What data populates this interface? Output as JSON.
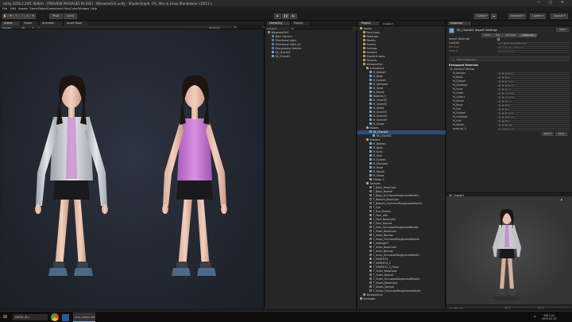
{
  "window": {
    "title": "Unity 2018.2.20f1 (64bit) - [PREVIEW PACKAGES IN USE] - WinsomeGirl.unity - ShaderGraph - PC, Mac & Linux Standalone <DX11>"
  },
  "menu": [
    "File",
    "Edit",
    "Assets",
    "GameObject",
    "Component",
    "PolyCube",
    "Window",
    "Help"
  ],
  "toolbar": {
    "pivot": "Pivot",
    "space": "Local",
    "collab": "Collab ▾",
    "account": "Account ▾",
    "layers": "Layers ▾",
    "layout": "Layout ▾"
  },
  "scene": {
    "tabs": [
      "Scene",
      "Game",
      "Animator",
      "Asset Store"
    ],
    "shading": "Shaded",
    "mode": "2D",
    "gizmos": "Gizmos ▾",
    "search": "All"
  },
  "hierarchy": {
    "tab": "Hierarchy",
    "project_tab": "Project",
    "create": "Create ▾",
    "search": "All",
    "items": [
      {
        "label": "WinsomeGirl*",
        "indent": 0,
        "icon": "scene"
      },
      {
        "label": "Main Camera",
        "indent": 1,
        "icon": "go"
      },
      {
        "label": "Directional Light",
        "indent": 1,
        "icon": "go"
      },
      {
        "label": "Directional Light (1)",
        "indent": 1,
        "icon": "go"
      },
      {
        "label": "Post-process Volume",
        "indent": 1,
        "icon": "go"
      },
      {
        "label": "SK_Chara01",
        "indent": 1,
        "icon": "prefab"
      },
      {
        "label": "SK_Chara01",
        "indent": 1,
        "icon": "prefab"
      }
    ]
  },
  "project": {
    "create": "Create ▾",
    "items": [
      {
        "label": "Assets",
        "indent": 0,
        "icon": "folder",
        "sel": false
      },
      {
        "label": "PolyCubes",
        "indent": 1,
        "icon": "folder",
        "sel": false
      },
      {
        "label": "Materials",
        "indent": 1,
        "icon": "folder",
        "sel": false
      },
      {
        "label": "Models",
        "indent": 1,
        "icon": "folder",
        "sel": false
      },
      {
        "label": "Scenes",
        "indent": 1,
        "icon": "folder",
        "sel": false
      },
      {
        "label": "Settings",
        "indent": 1,
        "icon": "folder",
        "sel": false
      },
      {
        "label": "Shaders",
        "indent": 1,
        "icon": "folder",
        "sel": false
      },
      {
        "label": "ShaderGraphs",
        "indent": 1,
        "icon": "folder",
        "sel": false
      },
      {
        "label": "Textures",
        "indent": 1,
        "icon": "folder",
        "sel": false
      },
      {
        "label": "WinsomeGirl",
        "indent": 1,
        "icon": "folder",
        "sel": false
      },
      {
        "label": "Animations",
        "indent": 2,
        "icon": "folder",
        "sel": false
      },
      {
        "label": "M_Bottom",
        "indent": 3,
        "icon": "mesh",
        "sel": false
      },
      {
        "label": "M_Body",
        "indent": 3,
        "icon": "mesh",
        "sel": false
      },
      {
        "label": "M_Eyeball",
        "indent": 3,
        "icon": "mesh",
        "sel": false
      },
      {
        "label": "M_Hairbase",
        "indent": 3,
        "icon": "mesh",
        "sel": false
      },
      {
        "label": "M_Head",
        "indent": 3,
        "icon": "mesh",
        "sel": false
      },
      {
        "label": "M_Mouth",
        "indent": 3,
        "icon": "mesh",
        "sel": false
      },
      {
        "label": "Material_5",
        "indent": 3,
        "icon": "mesh",
        "sel": false
      },
      {
        "label": "M_Outer01",
        "indent": 3,
        "icon": "mesh",
        "sel": false
      },
      {
        "label": "M_Outer02",
        "indent": 3,
        "icon": "mesh",
        "sel": false
      },
      {
        "label": "M_Shoes",
        "indent": 3,
        "icon": "mesh",
        "sel": false
      },
      {
        "label": "M_Outer03",
        "indent": 3,
        "icon": "mesh",
        "sel": false
      },
      {
        "label": "M_Outer04",
        "indent": 3,
        "icon": "mesh",
        "sel": false
      },
      {
        "label": "M_Outer05",
        "indent": 3,
        "icon": "mesh",
        "sel": false
      },
      {
        "label": "M_Shoes",
        "indent": 3,
        "icon": "mesh",
        "sel": false
      },
      {
        "label": "Models",
        "indent": 2,
        "icon": "folder",
        "sel": false
      },
      {
        "label": "SK_Chara01",
        "indent": 3,
        "icon": "prefab",
        "sel": true
      },
      {
        "label": "SK_Chara01",
        "indent": 4,
        "icon": "mesh",
        "sel": false
      },
      {
        "label": "Shaders",
        "indent": 2,
        "icon": "folder",
        "sel": false
      },
      {
        "label": "M_Bottom",
        "indent": 3,
        "icon": "mesh",
        "sel": false
      },
      {
        "label": "M_Body",
        "indent": 3,
        "icon": "mesh",
        "sel": false
      },
      {
        "label": "M_Eyes",
        "indent": 3,
        "icon": "mesh",
        "sel": false
      },
      {
        "label": "M_Face",
        "indent": 3,
        "icon": "mesh",
        "sel": false
      },
      {
        "label": "M_Eyeball",
        "indent": 3,
        "icon": "mesh",
        "sel": false
      },
      {
        "label": "M_Hairbase",
        "indent": 3,
        "icon": "mesh",
        "sel": false
      },
      {
        "label": "M_Head",
        "indent": 3,
        "icon": "mesh",
        "sel": false
      },
      {
        "label": "M_Mouth",
        "indent": 3,
        "icon": "mesh",
        "sel": false
      },
      {
        "label": "M_Shoes",
        "indent": 3,
        "icon": "mesh",
        "sel": false
      },
      {
        "label": "Shader 2",
        "indent": 3,
        "icon": "mesh",
        "sel": false
      },
      {
        "label": "Textures",
        "indent": 2,
        "icon": "folder",
        "sel": false
      },
      {
        "label": "T_Body_BaseColor",
        "indent": 3,
        "icon": "tex",
        "color": "#d9b3a0",
        "sel": false
      },
      {
        "label": "T_Body_Normal",
        "indent": 3,
        "icon": "tex",
        "color": "#8a8cf0",
        "sel": false
      },
      {
        "label": "T_Body_OcclusionRoughnessMetallic",
        "indent": 3,
        "icon": "tex",
        "color": "#cc4b2a",
        "sel": false
      },
      {
        "label": "T_Bottom_BaseColor",
        "indent": 3,
        "icon": "tex",
        "color": "#2a2a2a",
        "sel": false
      },
      {
        "label": "T_Bottom_OcclusionRoughnessMetallic",
        "indent": 3,
        "icon": "tex",
        "color": "#d24a2e",
        "sel": false
      },
      {
        "label": "T_Eye",
        "indent": 3,
        "icon": "tex",
        "color": "#3a2a20",
        "sel": false
      },
      {
        "label": "T_Eye_Normal",
        "indent": 3,
        "icon": "tex",
        "color": "#9a9af2",
        "sel": false
      },
      {
        "label": "T_Face_alfa",
        "indent": 3,
        "icon": "tex",
        "color": "#eeeeee",
        "sel": false
      },
      {
        "label": "T_Face_BaseColor",
        "indent": 3,
        "icon": "tex",
        "color": "#e1b9a5",
        "sel": false
      },
      {
        "label": "T_Face_Normal",
        "indent": 3,
        "icon": "tex",
        "color": "#8c8ef0",
        "sel": false
      },
      {
        "label": "T_Face_OcclusionRoughnessMetallic",
        "indent": 3,
        "icon": "tex",
        "color": "#c94d30",
        "sel": false
      },
      {
        "label": "T_Head_BaseColor",
        "indent": 3,
        "icon": "tex",
        "color": "#3b2b24",
        "sel": false
      },
      {
        "label": "T_Head_Normal",
        "indent": 3,
        "icon": "tex",
        "color": "#8d8ff0",
        "sel": false
      },
      {
        "label": "T_Head_OcclusionRoughnessMetallic",
        "indent": 3,
        "icon": "tex",
        "color": "#cf4c2c",
        "sel": false
      },
      {
        "label": "T_HighlightT",
        "indent": 3,
        "icon": "tex",
        "color": "#f2f2f2",
        "sel": false
      },
      {
        "label": "T_Inner_BaseColor",
        "indent": 3,
        "icon": "tex",
        "color": "#c86fd8",
        "sel": false
      },
      {
        "label": "T_Inner_Normal",
        "indent": 3,
        "icon": "tex",
        "color": "#8f90f0",
        "sel": false
      },
      {
        "label": "T_Inner_OcclusionRoughnessMetallic",
        "indent": 3,
        "icon": "tex",
        "color": "#d04d2c",
        "sel": false
      },
      {
        "label": "T_MSDF874",
        "indent": 3,
        "icon": "tex",
        "color": "#ffffff",
        "sel": false
      },
      {
        "label": "T_MSDF874_2",
        "indent": 3,
        "icon": "tex",
        "color": "#ffffff",
        "sel": false
      },
      {
        "label": "T_MSDF874_2_Fixed",
        "indent": 3,
        "icon": "tex",
        "color": "#f0f0f0",
        "sel": false
      },
      {
        "label": "T_Outer_BaseColor",
        "indent": 3,
        "icon": "tex",
        "color": "#d6d6d6",
        "sel": false
      },
      {
        "label": "T_Outer_Normal",
        "indent": 3,
        "icon": "tex",
        "color": "#9193f0",
        "sel": false
      },
      {
        "label": "T_Outer_OcclusionRoughnessMetallic",
        "indent": 3,
        "icon": "tex",
        "color": "#cd4e2e",
        "sel": false
      },
      {
        "label": "T_Shoes_BaseColor",
        "indent": 3,
        "icon": "tex",
        "color": "#3e5a74",
        "sel": false
      },
      {
        "label": "T_Shoes_Normal",
        "indent": 3,
        "icon": "tex",
        "color": "#8e90f0",
        "sel": false
      },
      {
        "label": "T_Shoes_OcclusionRoughnessMetallic",
        "indent": 3,
        "icon": "tex",
        "color": "#cc4c2d",
        "sel": false
      },
      {
        "label": "WinsomeGirl",
        "indent": 1,
        "icon": "scene",
        "sel": false
      },
      {
        "label": "Packages",
        "indent": 0,
        "icon": "folder",
        "sel": false
      }
    ]
  },
  "inspector": {
    "tab": "Inspector",
    "title": "SK_Chara01 Import Settings",
    "open": "Open",
    "tabs": [
      "Model",
      "Rig",
      "Animation",
      "Materials"
    ],
    "import_materials": "Import Materials",
    "location_label": "Location",
    "location_value": "Use Embedded Materials",
    "naming_label": "Naming",
    "naming_value": "From Model's Material",
    "search_label": "Search",
    "search_value": "Recursive-Up",
    "extract": "Extract Materials...",
    "remapped_title": "Remapped Materials",
    "on_demand": "On Demand Remap",
    "materials": [
      {
        "name": "M_Bottom",
        "value": "M_Bottom"
      },
      {
        "name": "M_Body",
        "value": "M_Body"
      },
      {
        "name": "M_Eyeball",
        "value": "M_Eyeball"
      },
      {
        "name": "M_Hairbase",
        "value": "M_Hairbase"
      },
      {
        "name": "M_Inner",
        "value": "M_Inner"
      },
      {
        "name": "M_Outer",
        "value": "M_Outer01"
      },
      {
        "name": "M_Outer1",
        "value": "M_Outer02"
      },
      {
        "name": "M_Shoes",
        "value": "M_Shoes"
      },
      {
        "name": "M_Body",
        "value": "M_Body"
      },
      {
        "name": "M_Eye",
        "value": "M_Eye"
      },
      {
        "name": "M_Eyeball",
        "value": "M_Eyeball"
      },
      {
        "name": "M_Hairbase",
        "value": "M_Hairbase"
      },
      {
        "name": "M_Hair",
        "value": "M_Hair"
      },
      {
        "name": "M_Mouth",
        "value": "M_Mouth"
      },
      {
        "name": "material_5",
        "value": "material_5"
      }
    ],
    "revert": "Revert",
    "apply": "Apply",
    "preview_title": "SK_Chara01",
    "asset_bundle": "AssetBundle",
    "ab_none": "None",
    "ab_none2": "None"
  },
  "taskbar": {
    "search": "DATAs (D:)",
    "app": "Unity 2018.2.20f1 ...",
    "time": "오후 1:41",
    "date": "2019-02-02",
    "lang": "A"
  },
  "colors": {
    "accent": "#2d4c78",
    "panel": "#262626",
    "topwear": "#c87ad6"
  }
}
